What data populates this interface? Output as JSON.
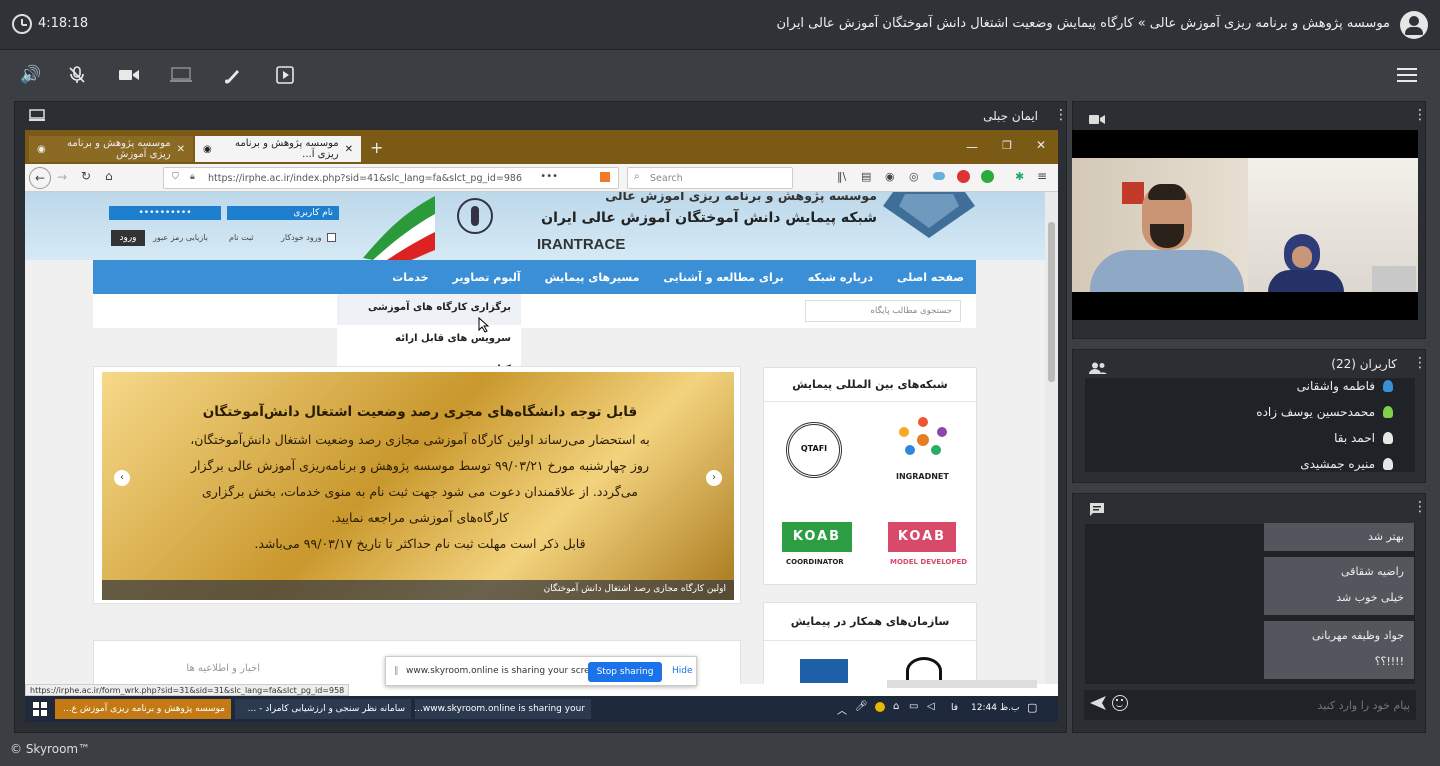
{
  "topbar": {
    "time": "4:18:18",
    "title": "موسسه پژوهش و برنامه ریزی آموزش عالی » کارگاه پیمایش وضعیت اشتغال دانش آموختگان آموزش عالی ایران"
  },
  "screen_panel": {
    "presenter": "ایمان جبلی"
  },
  "browser": {
    "tab1": "موسسه پژوهش و برنامه ریزی آموزش",
    "tab2": "موسسه پژوهش و برنامه ریزی آ...",
    "url": "https://irphe.ac.ir/index.php?sid=41&slc_lang=fa&slct_pg_id=986",
    "search_placeholder": "Search"
  },
  "site": {
    "org_name": "موسسه پژوهش و برنامه ریزی آموزش عالی",
    "network_name": "شبکه پیمایش دانش آموختگان آموزش عالی ایران",
    "brand": "IRANTRACE",
    "username_label": "نام کاربری",
    "password_mask": "••••••••••",
    "login_button": "ورود",
    "remember": "ورود خودکار",
    "register": "ثبت نام",
    "forgot": "بازیابی رمز عبور",
    "menu": [
      "صفحه اصلی",
      "درباره شبکه",
      "برای مطالعه و آشنایی",
      "مسیرهای پیمایش",
      "آلبوم تصاویر",
      "خدمات"
    ],
    "dropdown": [
      "برگزاری کارگاه های آموزشی",
      "سرویس های قابل ارائه",
      "کتاب"
    ],
    "site_search_placeholder": "جستجوی مطالب پایگاه",
    "slider": {
      "line1": "قابل توجه دانشگاه‌های مجری رصد وضعیت اشتغال دانش‌آموختگان",
      "line2": "به استحضار می‌رساند اولین کارگاه آموزشی مجازی رصد وضعیت اشتغال دانش‌آموختگان،",
      "line3": "روز چهارشنبه مورخ ۹۹/۰۳/۲۱ توسط موسسه پژوهش و برنامه‌ریزی آموزش عالی برگزار",
      "line4": "می‌گردد. از علاقمندان دعوت می شود جهت ثبت نام به منوی خدمات، بخش برگزاری",
      "line5": "کارگاه‌های آموزشی مراجعه نمایید.",
      "line6": "قابل ذکر است مهلت ثبت نام حداکثر تا تاریخ ۹۹/۰۳/۱۷ می‌باشد.",
      "caption": "اولین کارگاه مجازی رصد اشتغال دانش آموختگان"
    },
    "networks_title": "شبکه‌های بین المللی پیمایش",
    "logos": [
      "QTAFI",
      "INGRADNET",
      "KOAB",
      "COORDINATOR",
      "KOAB",
      "MODEL DEVELOPED"
    ],
    "partners_title": "سازمان‌های همکار در پیمایش",
    "news_title": "اخبار و اطلاعیه ها",
    "status_url": "https://irphe.ac.ir/form_wrk.php?sid=31&sid=31&slc_lang=fa&slct_pg_id=958",
    "sharing_text": "www.skyroom.online is sharing your screen.",
    "stop_sharing": "Stop sharing",
    "hide": "Hide"
  },
  "windows_taskbar": {
    "items": [
      "موسسه پژوهش و برنامه ریزی آموزش ع...",
      "سامانه نظر سنجی و ارزشیابی کامراد - ...",
      "www.skyroom.online is sharing your..."
    ],
    "clock": "12:44 ب.ظ",
    "lang": "فا"
  },
  "users": {
    "title": "کاربران (22)",
    "list": [
      "فاطمه واشقانی",
      "محمدحسین یوسف زاده",
      "احمد بقا",
      "منیره جمشیدی"
    ]
  },
  "chat": {
    "messages": [
      {
        "name": "",
        "text": "بهتر شد"
      },
      {
        "name": "راضیه شقاقی",
        "text": "خیلی خوب شد"
      },
      {
        "name": "جواد وظیفه مهربانی",
        "text": "!!!!؟؟"
      }
    ],
    "placeholder": "پیام خود را وارد کنید"
  },
  "footer": {
    "brand": "© Skyroom™"
  },
  "colors": {
    "accent": "#3a8fd6",
    "user_online": "#7fd14a",
    "user_mod": "#3a8fd6"
  }
}
